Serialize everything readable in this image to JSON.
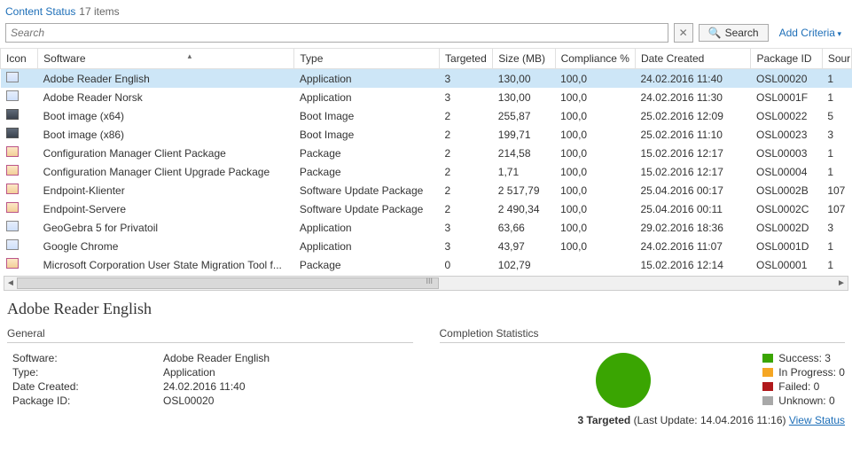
{
  "header": {
    "title": "Content Status",
    "count_text": "17 items"
  },
  "search": {
    "placeholder": "Search",
    "button": "Search",
    "add_criteria": "Add Criteria"
  },
  "columns": {
    "icon": "Icon",
    "software": "Software",
    "type": "Type",
    "targeted": "Targeted",
    "size": "Size (MB)",
    "compliance": "Compliance %",
    "date": "Date Created",
    "package_id": "Package ID",
    "source": "Sour"
  },
  "rows": [
    {
      "icon": "app",
      "sw": "Adobe Reader English",
      "type": "Application",
      "targ": "3",
      "size": "130,00",
      "comp": "100,0",
      "date": "24.02.2016 11:40",
      "pkg": "OSL00020",
      "src": "1",
      "sel": true
    },
    {
      "icon": "app",
      "sw": "Adobe Reader Norsk",
      "type": "Application",
      "targ": "3",
      "size": "130,00",
      "comp": "100,0",
      "date": "24.02.2016 11:30",
      "pkg": "OSL0001F",
      "src": "1"
    },
    {
      "icon": "disk",
      "sw": "Boot image (x64)",
      "type": "Boot Image",
      "targ": "2",
      "size": "255,87",
      "comp": "100,0",
      "date": "25.02.2016 12:09",
      "pkg": "OSL00022",
      "src": "5"
    },
    {
      "icon": "disk",
      "sw": "Boot image (x86)",
      "type": "Boot Image",
      "targ": "2",
      "size": "199,71",
      "comp": "100,0",
      "date": "25.02.2016 11:10",
      "pkg": "OSL00023",
      "src": "3"
    },
    {
      "icon": "pkg",
      "sw": "Configuration Manager Client Package",
      "type": "Package",
      "targ": "2",
      "size": "214,58",
      "comp": "100,0",
      "date": "15.02.2016 12:17",
      "pkg": "OSL00003",
      "src": "1"
    },
    {
      "icon": "pkg",
      "sw": "Configuration Manager Client Upgrade Package",
      "type": "Package",
      "targ": "2",
      "size": "1,71",
      "comp": "100,0",
      "date": "15.02.2016 12:17",
      "pkg": "OSL00004",
      "src": "1"
    },
    {
      "icon": "pkg",
      "sw": "Endpoint-Klienter",
      "type": "Software Update Package",
      "targ": "2",
      "size": "2 517,79",
      "comp": "100,0",
      "date": "25.04.2016 00:17",
      "pkg": "OSL0002B",
      "src": "107"
    },
    {
      "icon": "pkg",
      "sw": "Endpoint-Servere",
      "type": "Software Update Package",
      "targ": "2",
      "size": "2 490,34",
      "comp": "100,0",
      "date": "25.04.2016 00:11",
      "pkg": "OSL0002C",
      "src": "107"
    },
    {
      "icon": "app",
      "sw": "GeoGebra 5 for Privatoil",
      "type": "Application",
      "targ": "3",
      "size": "63,66",
      "comp": "100,0",
      "date": "29.02.2016 18:36",
      "pkg": "OSL0002D",
      "src": "3"
    },
    {
      "icon": "app",
      "sw": "Google Chrome",
      "type": "Application",
      "targ": "3",
      "size": "43,97",
      "comp": "100,0",
      "date": "24.02.2016 11:07",
      "pkg": "OSL0001D",
      "src": "1"
    },
    {
      "icon": "pkg",
      "sw": "Microsoft Corporation User State Migration Tool f...",
      "type": "Package",
      "targ": "0",
      "size": "102,79",
      "comp": "",
      "date": "15.02.2016 12:14",
      "pkg": "OSL00001",
      "src": "1"
    }
  ],
  "detail": {
    "title": "Adobe Reader English",
    "general_label": "General",
    "stats_label": "Completion Statistics",
    "kv": {
      "software_k": "Software:",
      "software_v": "Adobe Reader English",
      "type_k": "Type:",
      "type_v": "Application",
      "date_k": "Date Created:",
      "date_v": "24.02.2016 11:40",
      "pkg_k": "Package ID:",
      "pkg_v": "OSL00020"
    },
    "legend": {
      "success": "Success: 3",
      "progress": "In Progress: 0",
      "failed": "Failed: 0",
      "unknown": "Unknown: 0"
    },
    "colors": {
      "success": "#3aa502",
      "progress": "#f5a623",
      "failed": "#b0191b",
      "unknown": "#a8a8a8"
    },
    "targeted_b": "3 Targeted",
    "targeted_rest": " (Last Update: 14.04.2016 11:16) ",
    "view_status": "View Status"
  }
}
